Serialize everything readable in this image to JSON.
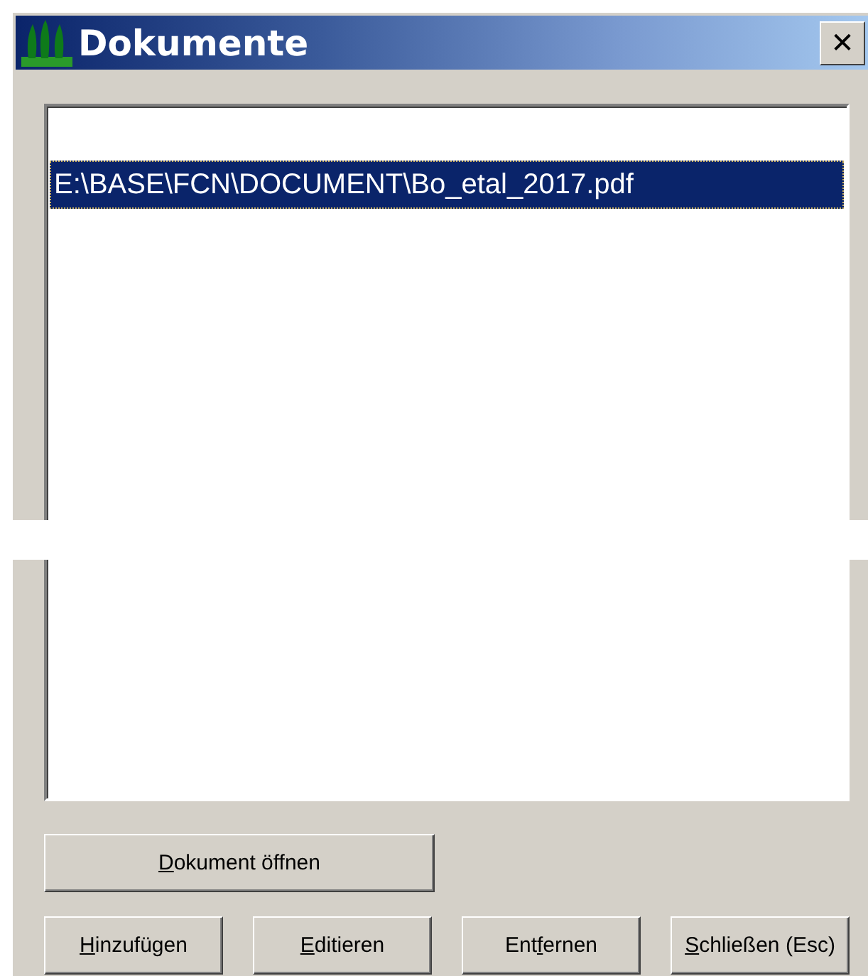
{
  "window": {
    "title": "Dokumente",
    "close": "✕"
  },
  "documents": [
    {
      "path": "E:\\BASE\\FCN\\DOCUMENT\\Bo_etal_2017.pdf",
      "selected": true
    }
  ],
  "buttons": [
    {
      "mnemonic": "D",
      "after": "okument öffnen",
      "kind": "wide"
    },
    {
      "mnemonic": "H",
      "after": "inzufügen",
      "kind": "row"
    },
    {
      "mnemonic": "E",
      "after": "ditieren",
      "kind": "row"
    },
    {
      "before": "Ent",
      "mnemonic": "f",
      "after": "ernen",
      "kind": "row"
    },
    {
      "mnemonic": "S",
      "after": "chließen (Esc)",
      "kind": "row"
    }
  ]
}
